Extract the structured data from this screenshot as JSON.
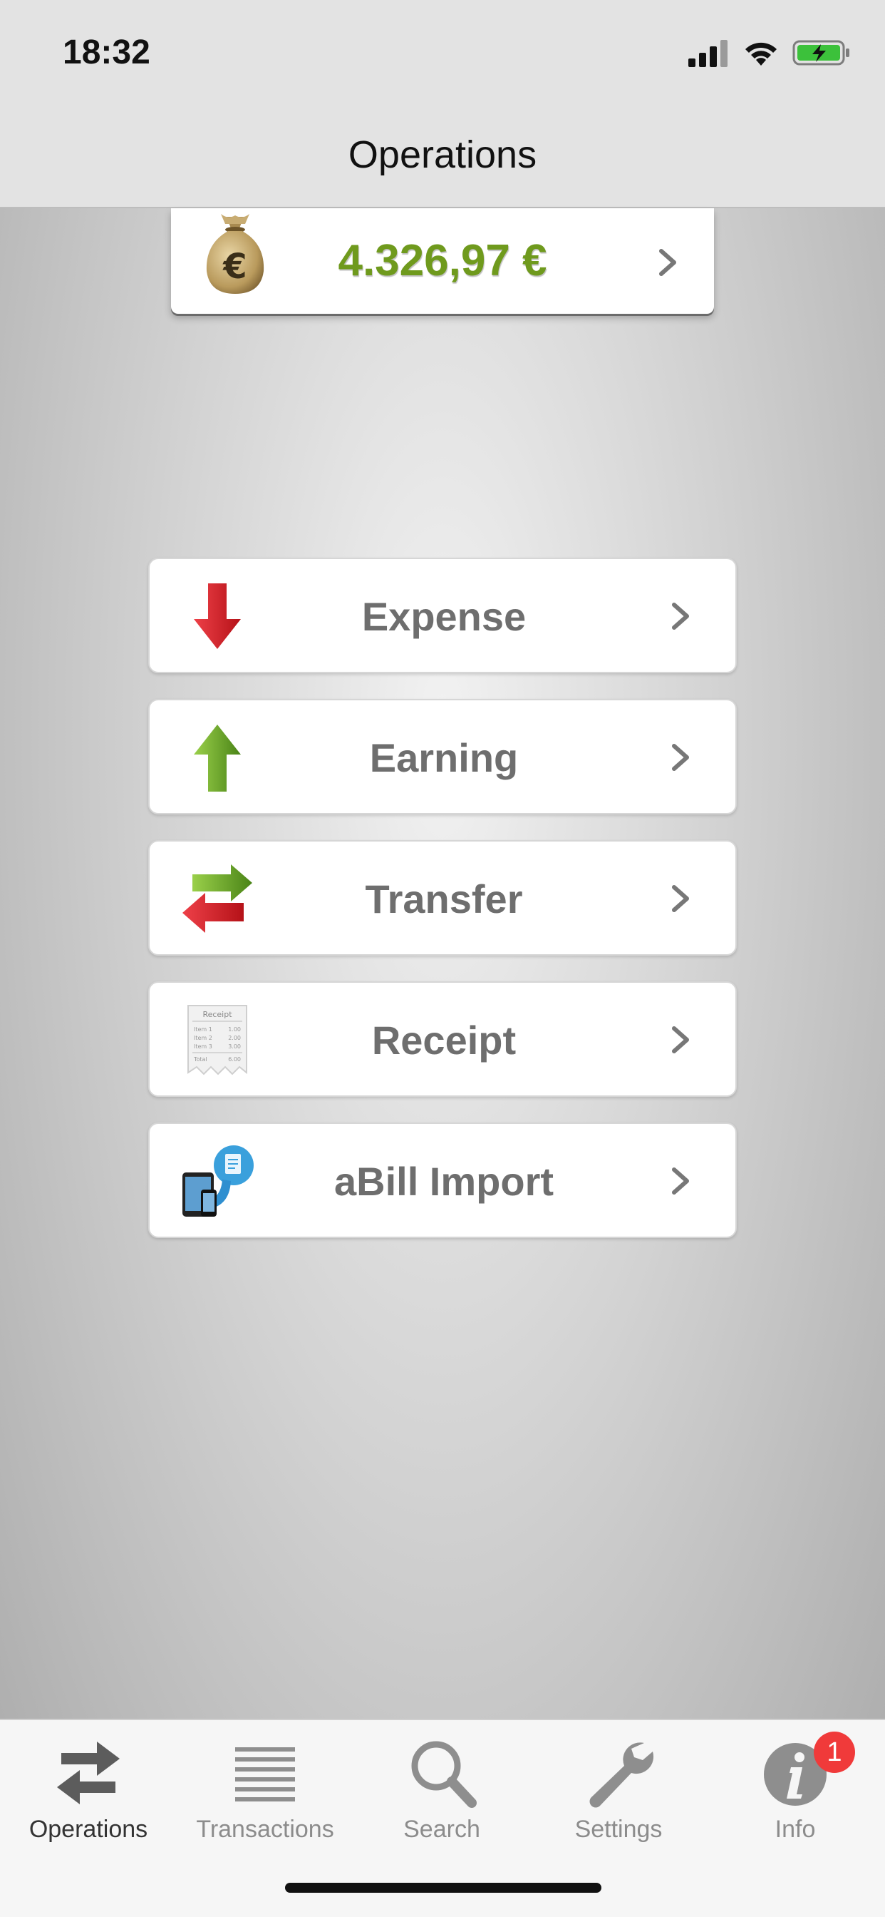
{
  "status_bar": {
    "time": "18:32"
  },
  "nav": {
    "title": "Operations"
  },
  "balance": {
    "amount": "4.326,97 €"
  },
  "operations": [
    {
      "label": "Expense",
      "icon": "expense-arrow-down-icon"
    },
    {
      "label": "Earning",
      "icon": "earning-arrow-up-icon"
    },
    {
      "label": "Transfer",
      "icon": "transfer-arrows-icon"
    },
    {
      "label": "Receipt",
      "icon": "receipt-icon"
    },
    {
      "label": "aBill Import",
      "icon": "abill-import-icon"
    }
  ],
  "receipt_icon_text": {
    "title": "Receipt",
    "lines": [
      [
        "Item 1",
        "1.00"
      ],
      [
        "Item 2",
        "2.00"
      ],
      [
        "Item 3",
        "3.00"
      ]
    ],
    "total": [
      "Total",
      "6.00"
    ]
  },
  "tabs": [
    {
      "label": "Operations",
      "icon": "swap-arrows-icon",
      "active": true
    },
    {
      "label": "Transactions",
      "icon": "list-icon",
      "active": false
    },
    {
      "label": "Search",
      "icon": "magnifier-icon",
      "active": false
    },
    {
      "label": "Settings",
      "icon": "wrench-icon",
      "active": false
    },
    {
      "label": "Info",
      "icon": "info-icon",
      "active": false,
      "badge": "1"
    }
  ],
  "colors": {
    "balance_green": "#6f9a1d",
    "expense_red": "#d8232a",
    "earning_green": "#6aa324",
    "badge_red": "#f03a3a"
  }
}
